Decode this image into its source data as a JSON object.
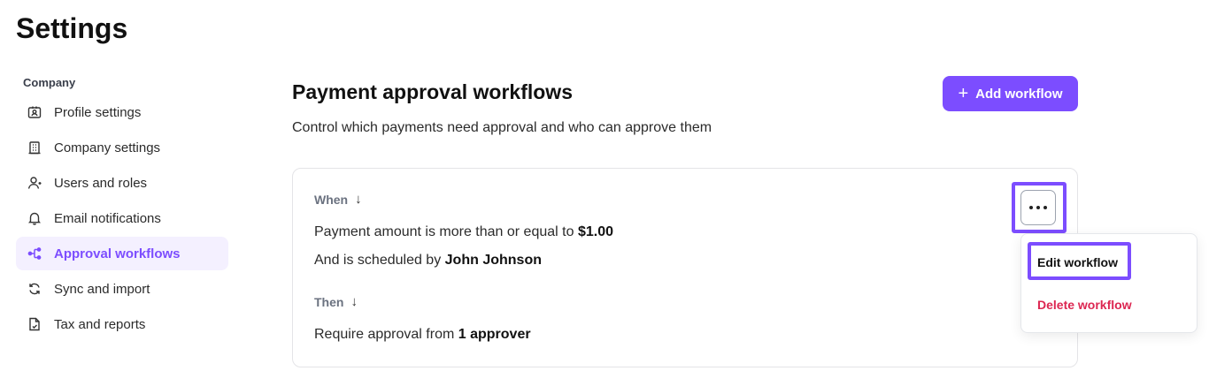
{
  "page": {
    "title": "Settings"
  },
  "sidebar": {
    "section_label": "Company",
    "items": [
      {
        "label": "Profile settings",
        "icon": "id-card-icon",
        "active": false
      },
      {
        "label": "Company settings",
        "icon": "building-icon",
        "active": false
      },
      {
        "label": "Users and roles",
        "icon": "user-icon",
        "active": false
      },
      {
        "label": "Email notifications",
        "icon": "bell-icon",
        "active": false
      },
      {
        "label": "Approval workflows",
        "icon": "workflow-icon",
        "active": true
      },
      {
        "label": "Sync and import",
        "icon": "sync-icon",
        "active": false
      },
      {
        "label": "Tax and reports",
        "icon": "document-icon",
        "active": false
      }
    ]
  },
  "main": {
    "title": "Payment approval workflows",
    "subtitle": "Control which payments need approval and who can approve them",
    "add_button_label": "Add workflow"
  },
  "workflow": {
    "when_label": "When",
    "condition1_prefix": "Payment amount is more than or equal to",
    "condition1_value": "$1.00",
    "condition2_prefix": "And is scheduled by",
    "condition2_value": "John Johnson",
    "then_label": "Then",
    "action_prefix": "Require approval from",
    "action_value": "1 approver"
  },
  "menu": {
    "edit_label": "Edit workflow",
    "delete_label": "Delete workflow"
  },
  "colors": {
    "accent": "#7c4dff",
    "danger": "#dc2651",
    "active_bg": "#f4f0ff"
  }
}
